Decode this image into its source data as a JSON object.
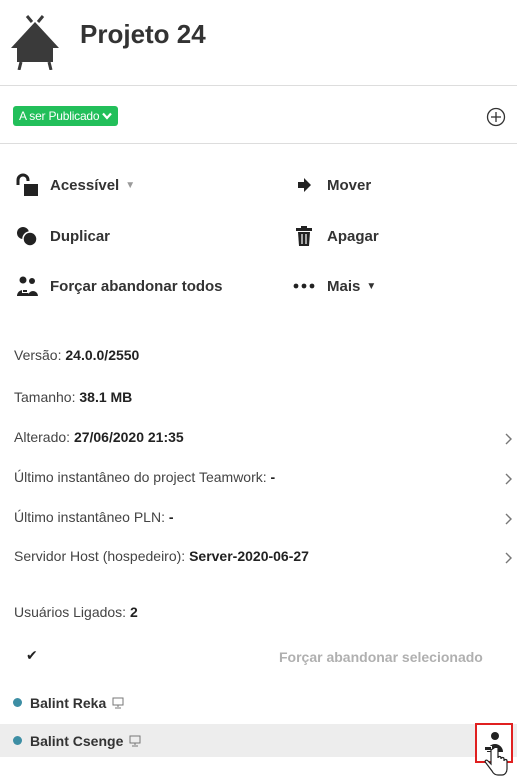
{
  "header": {
    "title": "Projeto 24",
    "logo_icon": "house-icon"
  },
  "status": {
    "badge": "A ser Publicado",
    "badge_icon": "chevron-down-icon",
    "badge_color": "#22bf5a",
    "add_icon": "plus-circle-icon"
  },
  "actions": {
    "accessible": "Acessível",
    "move": "Mover",
    "duplicate": "Duplicar",
    "delete": "Apagar",
    "force_leave_all": "Forçar abandonar todos",
    "more": "Mais"
  },
  "info": {
    "version_label": "Versão:",
    "version_value": "24.0.0/2550",
    "size_label": "Tamanho:",
    "size_value": "38.1 MB",
    "modified_label": "Alterado:",
    "modified_value": "27/06/2020 21:35",
    "teamwork_label": "Último instantâneo do project Teamwork:",
    "teamwork_value": "-",
    "pln_label": "Último instantâneo PLN:",
    "pln_value": "-",
    "host_label": "Servidor Host (hospedeiro):",
    "host_value": "Server-2020-06-27"
  },
  "users": {
    "connected_label": "Usuários Ligados:",
    "connected_count": "2",
    "check_mark": "✔",
    "force_selected": "Forçar abandonar selecionado",
    "dot_color": "#3d8ea4",
    "list": [
      {
        "name": "Balint Reka"
      },
      {
        "name": "Balint Csenge"
      }
    ]
  },
  "colors": {
    "accent": "#22bf5a",
    "highlight_border": "#e02020"
  }
}
